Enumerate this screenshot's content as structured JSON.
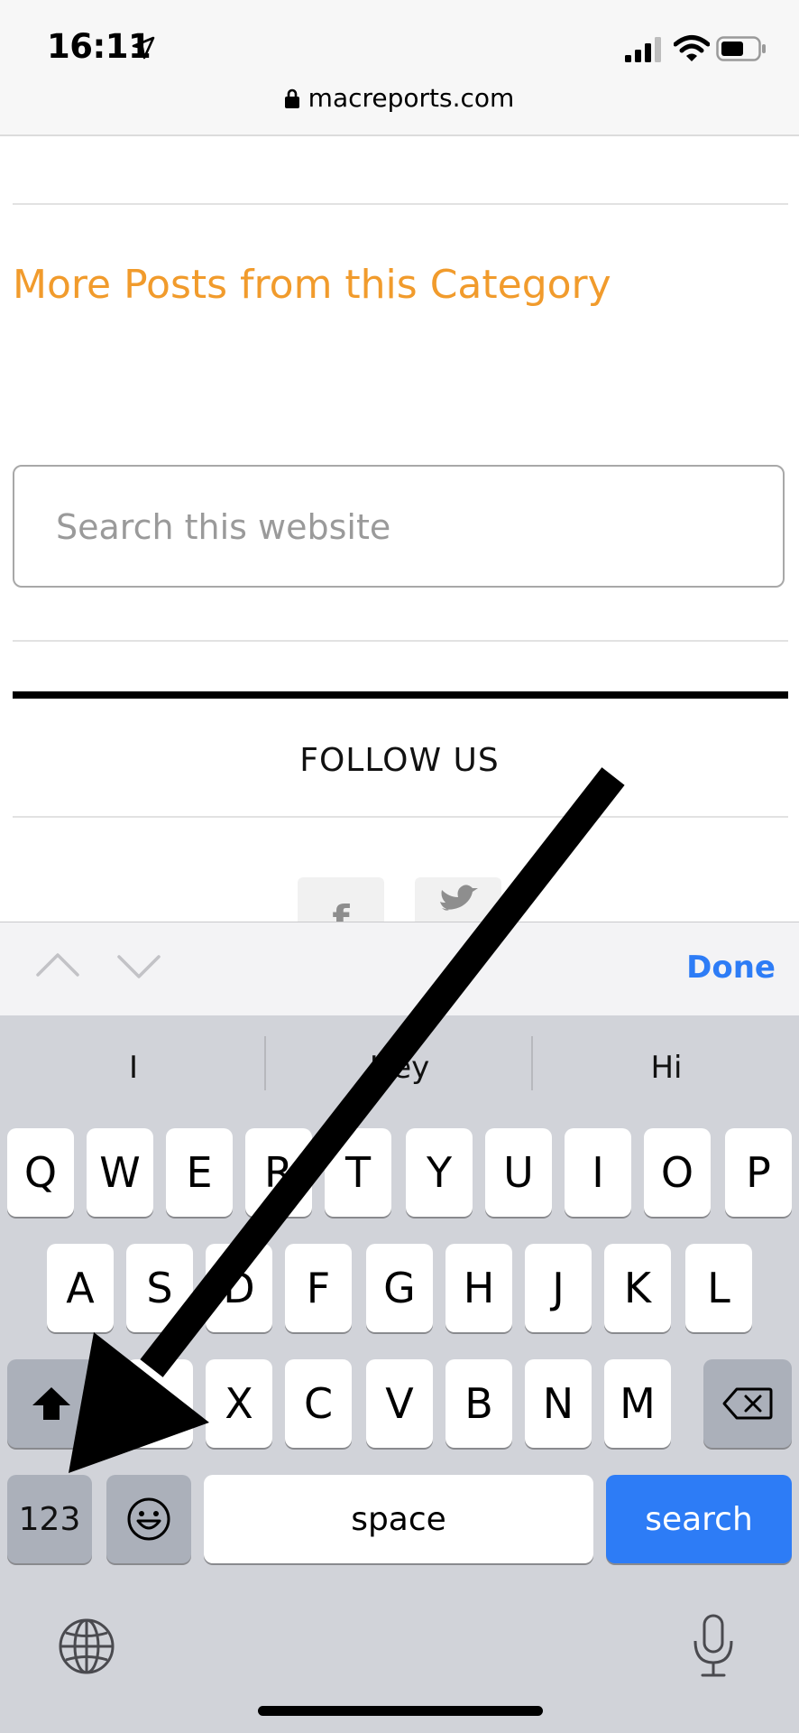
{
  "status_bar": {
    "time": "16:11"
  },
  "url_bar": {
    "domain": "macreports.com"
  },
  "content": {
    "section_heading": "More Posts from this Category",
    "search_placeholder": "Search this website",
    "follow_heading": "FOLLOW US",
    "social_icons": [
      "facebook-icon",
      "twitter-icon"
    ]
  },
  "accessory_bar": {
    "done_label": "Done"
  },
  "keyboard": {
    "suggestions": [
      "I",
      "Hey",
      "Hi"
    ],
    "row1": [
      "Q",
      "W",
      "E",
      "R",
      "T",
      "Y",
      "U",
      "I",
      "O",
      "P"
    ],
    "row2": [
      "A",
      "S",
      "D",
      "F",
      "G",
      "H",
      "J",
      "K",
      "L"
    ],
    "row3": [
      "X",
      "C",
      "V",
      "B",
      "N",
      "M"
    ],
    "numbers_label": "123",
    "space_label": "space",
    "search_label": "search"
  },
  "colors": {
    "heading_orange": "#f19b2c",
    "link_blue": "#2d7cf6",
    "keyboard_bg": "#d1d3d9"
  }
}
